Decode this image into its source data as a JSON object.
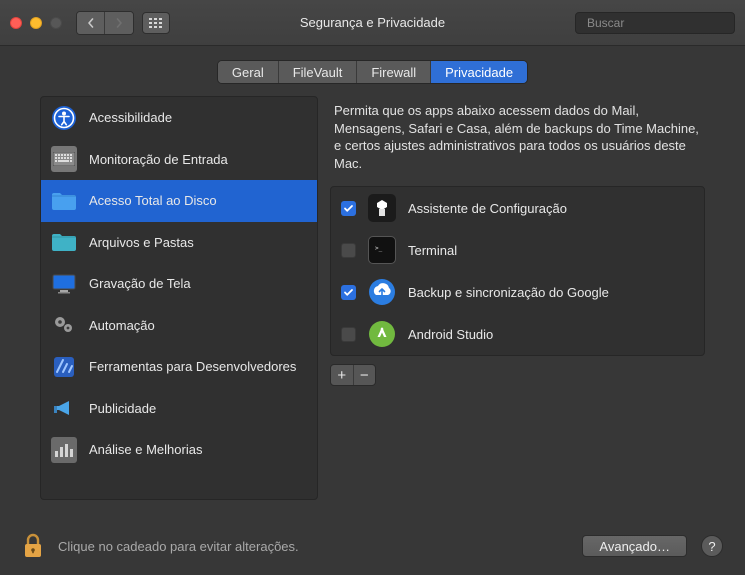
{
  "window": {
    "title": "Segurança e Privacidade",
    "search_placeholder": "Buscar"
  },
  "tabs": {
    "items": [
      "Geral",
      "FileVault",
      "Firewall",
      "Privacidade"
    ],
    "active_index": 3
  },
  "sidebar": {
    "items": [
      {
        "label": "Acessibilidade",
        "icon": "accessibility-icon"
      },
      {
        "label": "Monitoração de Entrada",
        "icon": "keyboard-icon"
      },
      {
        "label": "Acesso Total ao Disco",
        "icon": "folder-icon-blue"
      },
      {
        "label": "Arquivos e Pastas",
        "icon": "folder-icon-teal"
      },
      {
        "label": "Gravação de Tela",
        "icon": "screen-icon"
      },
      {
        "label": "Automação",
        "icon": "gears-icon"
      },
      {
        "label": "Ferramentas para Desenvolvedores",
        "icon": "devtools-icon"
      },
      {
        "label": "Publicidade",
        "icon": "megaphone-icon"
      },
      {
        "label": "Análise e Melhorias",
        "icon": "analytics-icon"
      }
    ],
    "selected_index": 2
  },
  "pane": {
    "description": "Permita que os apps abaixo acessem dados do Mail, Mensagens, Safari e Casa, além de backups do Time Machine, e certos ajustes administrativos para todos os usuários deste Mac.",
    "apps": [
      {
        "label": "Assistente de Configuração",
        "checked": true,
        "icon": "setup-assistant-icon"
      },
      {
        "label": "Terminal",
        "checked": false,
        "icon": "terminal-icon"
      },
      {
        "label": "Backup e sincronização do Google",
        "checked": true,
        "icon": "google-backup-icon"
      },
      {
        "label": "Android Studio",
        "checked": false,
        "icon": "android-studio-icon"
      }
    ]
  },
  "footer": {
    "lock_text": "Clique no cadeado para evitar alterações.",
    "advanced_label": "Avançado…"
  }
}
